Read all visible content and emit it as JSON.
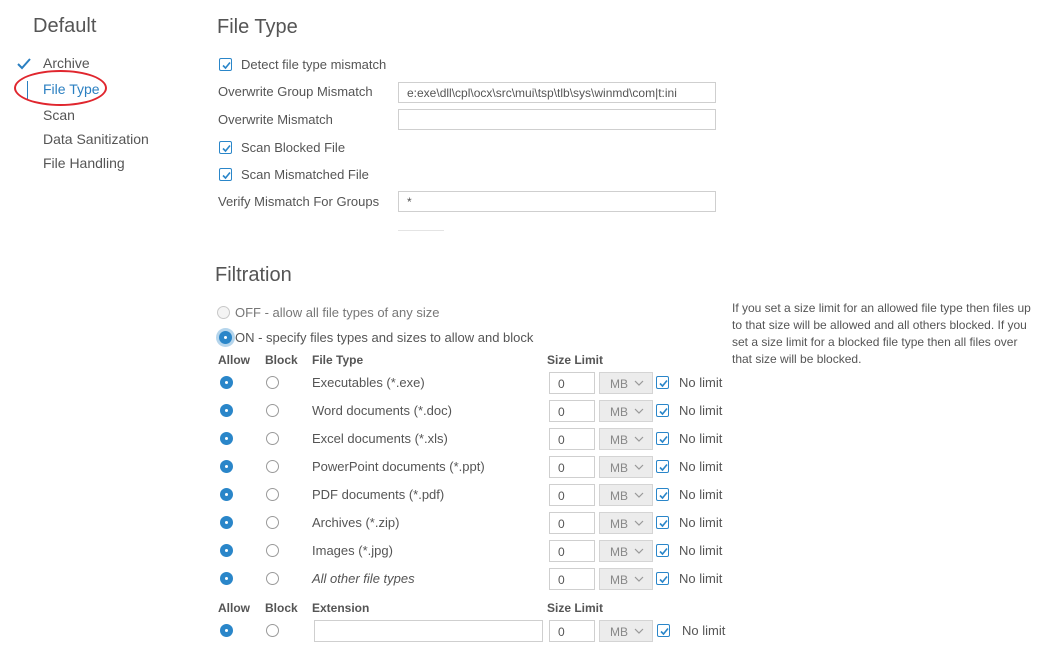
{
  "sidebar": {
    "title": "Default",
    "items": [
      {
        "label": "Archive"
      },
      {
        "label": "File Type"
      },
      {
        "label": "Scan"
      },
      {
        "label": "Data Sanitization"
      },
      {
        "label": "File Handling"
      }
    ]
  },
  "file_type": {
    "title": "File Type",
    "detect_mismatch_label": "Detect file type mismatch",
    "overwrite_group_mismatch_label": "Overwrite Group Mismatch",
    "overwrite_group_mismatch_value": "e:exe\\dll\\cpl\\ocx\\src\\mui\\tsp\\tlb\\sys\\winmd\\com|t:ini",
    "overwrite_mismatch_label": "Overwrite Mismatch",
    "overwrite_mismatch_value": "",
    "scan_blocked_label": "Scan Blocked File",
    "scan_mismatched_label": "Scan Mismatched File",
    "verify_mismatch_label": "Verify Mismatch For Groups",
    "verify_mismatch_value": "*"
  },
  "filtration": {
    "title": "Filtration",
    "off_label": "OFF - allow all file types of any size",
    "on_label": "ON - specify files types and sizes to allow and block",
    "help_text": "If you set a size limit for an allowed file type then files up to that size will be allowed and all others blocked. If you set a size limit for a blocked file type then all files over that size will be blocked.",
    "headers": {
      "allow": "Allow",
      "block": "Block",
      "file_type": "File Type",
      "size_limit": "Size Limit",
      "extension": "Extension"
    },
    "rows": [
      {
        "type": "Executables (*.exe)",
        "size": "0",
        "unit": "MB",
        "no_limit": "No limit"
      },
      {
        "type": "Word documents (*.doc)",
        "size": "0",
        "unit": "MB",
        "no_limit": "No limit"
      },
      {
        "type": "Excel documents (*.xls)",
        "size": "0",
        "unit": "MB",
        "no_limit": "No limit"
      },
      {
        "type": "PowerPoint documents (*.ppt)",
        "size": "0",
        "unit": "MB",
        "no_limit": "No limit"
      },
      {
        "type": "PDF documents (*.pdf)",
        "size": "0",
        "unit": "MB",
        "no_limit": "No limit"
      },
      {
        "type": "Archives (*.zip)",
        "size": "0",
        "unit": "MB",
        "no_limit": "No limit"
      },
      {
        "type": "Images (*.jpg)",
        "size": "0",
        "unit": "MB",
        "no_limit": "No limit"
      },
      {
        "type": "All other file types",
        "size": "0",
        "unit": "MB",
        "no_limit": "No limit"
      }
    ],
    "extension_row": {
      "value": "",
      "size": "0",
      "unit": "MB",
      "no_limit": "No limit"
    }
  },
  "colors": {
    "accent": "#2a86c9",
    "highlight_oval": "#e0262e",
    "text": "#555555"
  }
}
